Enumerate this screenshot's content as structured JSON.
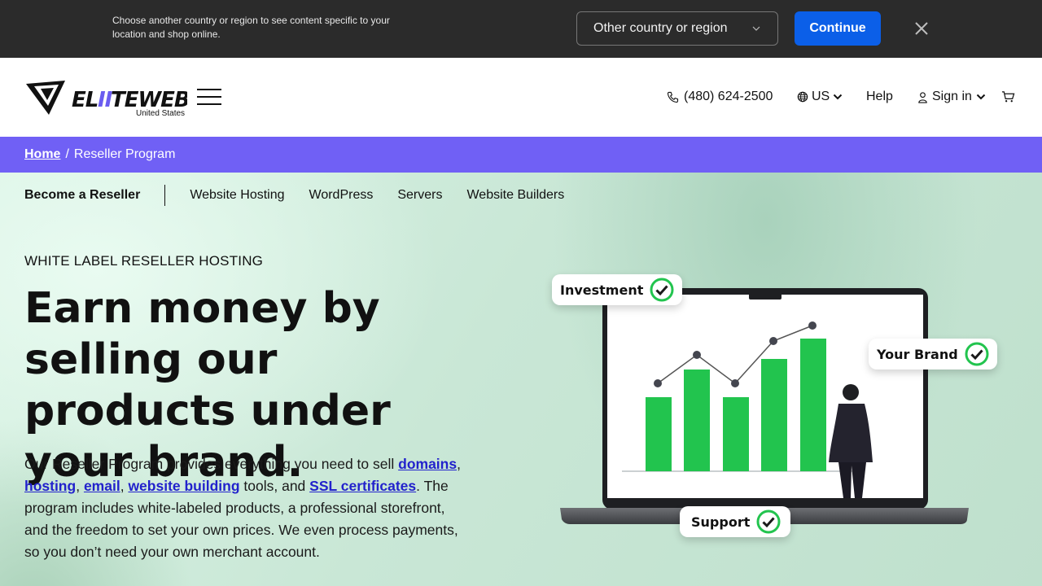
{
  "country_bar": {
    "message": "Choose another country or region to see content specific to your location and shop online.",
    "select_value": "Other country or region",
    "continue_label": "Continue"
  },
  "header": {
    "logo_text": "ELITEWEB.CO",
    "logo_region": "United States",
    "phone": "(480) 624-2500",
    "locale": "US",
    "help": "Help",
    "sign_in": "Sign in"
  },
  "breadcrumb": {
    "home": "Home",
    "separator": "/",
    "current": "Reseller Program"
  },
  "subnav": {
    "items": [
      "Become a Reseller",
      "Website Hosting",
      "WordPress",
      "Servers",
      "Website Builders"
    ]
  },
  "hero": {
    "eyebrow": "WHITE LABEL RESELLER HOSTING",
    "headline": "Earn money by selling our products under your brand.",
    "body": {
      "p1": "Our Reseller Program provides everything you need to sell ",
      "link_domains": "domains",
      "p2": ",",
      "link_hosting": "hosting",
      "p3": ",",
      "link_email": "email",
      "p4": ",",
      "link_website_building": "website building",
      "p5": " tools, and ",
      "link_ssl": "SSL certificates",
      "p6": ". The program includes white-labeled products, a professional storefront, and the freedom to set your own prices. We even process payments, so you don’t need your own merchant account."
    },
    "illustration": {
      "tag_investment": "Investment",
      "tag_brand": "Your Brand",
      "tag_support": "Support"
    }
  },
  "colors": {
    "country_bar_bg": "#2b2b2b",
    "continue_bg": "#0b5fe8",
    "breadcrumb_bg": "#7060f5",
    "bar_green": "#22c44e",
    "link": "#2222cc"
  }
}
